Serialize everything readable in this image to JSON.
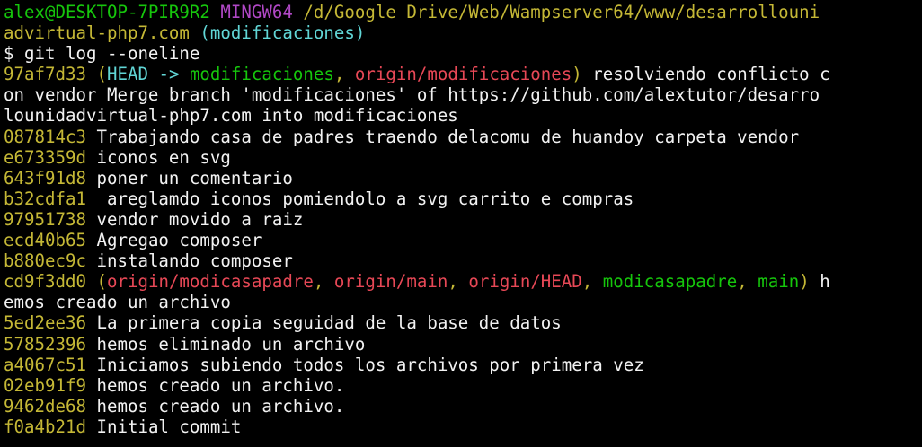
{
  "colors": {
    "background": "#000000",
    "default": "#f2f2f2",
    "green": "#16c60c",
    "purple": "#b148c6",
    "yellow": "#c5b836",
    "cyan": "#3a96dd",
    "bright_cyan": "#61d6d6",
    "bright_green": "#16c60c",
    "red": "#e74856"
  },
  "terminal": {
    "lines": [
      [
        {
          "text": "alex@DESKTOP-7PIR9R2",
          "color": "green"
        },
        {
          "text": " ",
          "color": "default"
        },
        {
          "text": "MINGW64",
          "color": "purple"
        },
        {
          "text": " ",
          "color": "default"
        },
        {
          "text": "/d/Google Drive/Web/Wampserver64/www/desarrollouni",
          "color": "yellow"
        }
      ],
      [
        {
          "text": "advirtual-php7.com",
          "color": "yellow"
        },
        {
          "text": " ",
          "color": "default"
        },
        {
          "text": "(modificaciones)",
          "color": "bright_cyan"
        }
      ],
      [
        {
          "text": "$ git log --oneline",
          "color": "default"
        }
      ],
      [
        {
          "text": "97af7d33",
          "color": "yellow"
        },
        {
          "text": " ",
          "color": "default"
        },
        {
          "text": "(",
          "color": "yellow"
        },
        {
          "text": "HEAD -> ",
          "color": "bright_cyan"
        },
        {
          "text": "modificaciones",
          "color": "bright_green"
        },
        {
          "text": ", ",
          "color": "yellow"
        },
        {
          "text": "origin/modificaciones",
          "color": "red"
        },
        {
          "text": ")",
          "color": "yellow"
        },
        {
          "text": " resolviendo conflicto c",
          "color": "default"
        }
      ],
      [
        {
          "text": "on vendor Merge branch 'modificaciones' of https://github.com/alextutor/desarro",
          "color": "default"
        }
      ],
      [
        {
          "text": "lounidadvirtual-php7.com into modificaciones",
          "color": "default"
        }
      ],
      [
        {
          "text": "087814c3",
          "color": "yellow"
        },
        {
          "text": " Trabajando casa de padres traendo delacomu de huandoy carpeta vendor",
          "color": "default"
        }
      ],
      [
        {
          "text": "e673359d",
          "color": "yellow"
        },
        {
          "text": " iconos en svg",
          "color": "default"
        }
      ],
      [
        {
          "text": "643f91d8",
          "color": "yellow"
        },
        {
          "text": " poner un comentario",
          "color": "default"
        }
      ],
      [
        {
          "text": "b32cdfa1",
          "color": "yellow"
        },
        {
          "text": "  areglamdo iconos pomiendolo a svg carrito e compras",
          "color": "default"
        }
      ],
      [
        {
          "text": "97951738",
          "color": "yellow"
        },
        {
          "text": " vendor movido a raiz",
          "color": "default"
        }
      ],
      [
        {
          "text": "ecd40b65",
          "color": "yellow"
        },
        {
          "text": " Agregao composer",
          "color": "default"
        }
      ],
      [
        {
          "text": "b880ec9c",
          "color": "yellow"
        },
        {
          "text": " instalando composer",
          "color": "default"
        }
      ],
      [
        {
          "text": "cd9f3dd0",
          "color": "yellow"
        },
        {
          "text": " ",
          "color": "default"
        },
        {
          "text": "(",
          "color": "yellow"
        },
        {
          "text": "origin/modicasapadre",
          "color": "red"
        },
        {
          "text": ", ",
          "color": "yellow"
        },
        {
          "text": "origin/main",
          "color": "red"
        },
        {
          "text": ", ",
          "color": "yellow"
        },
        {
          "text": "origin/HEAD",
          "color": "red"
        },
        {
          "text": ", ",
          "color": "yellow"
        },
        {
          "text": "modicasapadre",
          "color": "bright_green"
        },
        {
          "text": ", ",
          "color": "yellow"
        },
        {
          "text": "main",
          "color": "bright_green"
        },
        {
          "text": ")",
          "color": "yellow"
        },
        {
          "text": " h",
          "color": "default"
        }
      ],
      [
        {
          "text": "emos creado un archivo",
          "color": "default"
        }
      ],
      [
        {
          "text": "5ed2ee36",
          "color": "yellow"
        },
        {
          "text": " La primera copia seguidad de la base de datos",
          "color": "default"
        }
      ],
      [
        {
          "text": "57852396",
          "color": "yellow"
        },
        {
          "text": " hemos eliminado un archivo",
          "color": "default"
        }
      ],
      [
        {
          "text": "a4067c51",
          "color": "yellow"
        },
        {
          "text": " Iniciamos subiendo todos los archivos por primera vez",
          "color": "default"
        }
      ],
      [
        {
          "text": "02eb91f9",
          "color": "yellow"
        },
        {
          "text": " hemos creado un archivo.",
          "color": "default"
        }
      ],
      [
        {
          "text": "9462de68",
          "color": "yellow"
        },
        {
          "text": " hemos creado un archivo.",
          "color": "default"
        }
      ],
      [
        {
          "text": "f0a4b21d",
          "color": "yellow"
        },
        {
          "text": " Initial commit",
          "color": "default"
        }
      ]
    ]
  }
}
